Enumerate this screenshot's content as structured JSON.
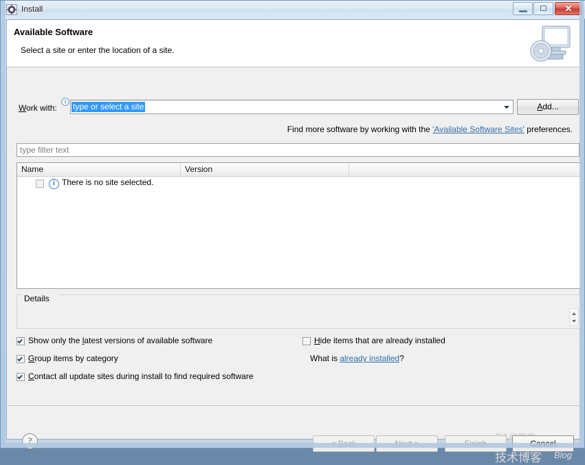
{
  "window": {
    "title": "Install",
    "icon": "eclipse-gear-icon",
    "minimize_label": "",
    "maximize_label": "",
    "close_label": "✕"
  },
  "banner": {
    "title": "Available Software",
    "subtitle": "Select a site or enter the location of a site.",
    "icon": "monitor-with-disc-icon"
  },
  "work_with": {
    "label_prefix": "W",
    "label_rest": "ork with:",
    "info_icon": "i",
    "combo_value": "type or select a site",
    "add_button_prefix": "A",
    "add_button_rest": "dd...",
    "hint_before": "Find more software by working with the ",
    "hint_link": "'Available Software Sites'",
    "hint_after": " preferences."
  },
  "filter": {
    "placeholder": "type filter text",
    "value": ""
  },
  "table": {
    "columns": [
      "Name",
      "Version",
      ""
    ],
    "rows": [
      {
        "checked": false,
        "icon": "info-icon",
        "name": "There is no site selected.",
        "version": ""
      }
    ]
  },
  "details": {
    "label": "Details",
    "content": "",
    "spinner_up": "up-arrow-icon",
    "spinner_down": "down-arrow-icon"
  },
  "options": [
    {
      "id": "show-latest",
      "checked": true,
      "mnemonic_before": "Show only the ",
      "mnemonic": "l",
      "mnemonic_after": "atest versions of available software"
    },
    {
      "id": "group-by-category",
      "checked": true,
      "mnemonic_before": "",
      "mnemonic": "G",
      "mnemonic_after": "roup items by category"
    },
    {
      "id": "contact-all-sites",
      "checked": true,
      "mnemonic_before": "",
      "mnemonic": "C",
      "mnemonic_after": "ontact all update sites during install to find required software"
    },
    {
      "id": "hide-installed",
      "checked": false,
      "mnemonic_before": "",
      "mnemonic": "H",
      "mnemonic_after": "ide items that are already installed"
    }
  ],
  "what_is": {
    "before": "What is ",
    "link": "already installed",
    "after": "?"
  },
  "buttons": {
    "help": "?",
    "back": {
      "prefix": "< ",
      "mnemonic": "B",
      "rest": "ack",
      "enabled": false
    },
    "next": {
      "prefix": "",
      "mnemonic": "N",
      "rest": "ext >",
      "enabled": false
    },
    "finish": {
      "prefix": "",
      "mnemonic": "F",
      "rest": "inish",
      "enabled": false
    },
    "cancel": {
      "label": "Cancel",
      "enabled": true
    }
  },
  "watermark": {
    "line1": "51CTO.com",
    "line2": "技术博客",
    "line3": "Blog"
  },
  "colors": {
    "selection_blue": "#3399ff",
    "link_blue": "#2f6fa8",
    "close_red": "#c6382c",
    "dialog_bg": "#f0f0f0",
    "banner_bg": "#ffffff"
  }
}
